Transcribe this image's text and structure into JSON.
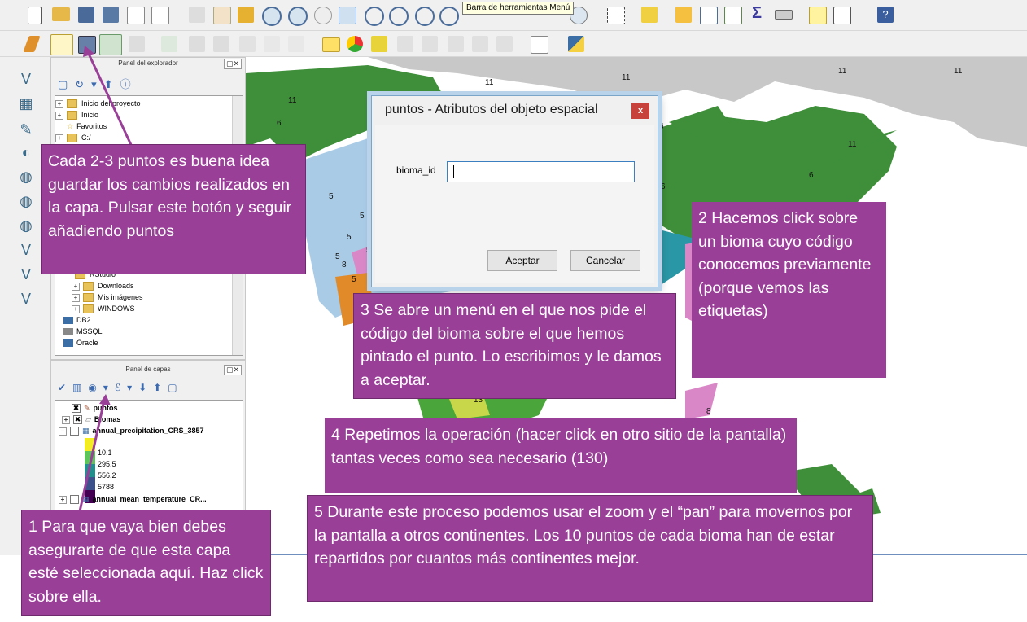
{
  "tooltip": "Barra de herramientas Menú",
  "browser_panel": {
    "title": "Panel del explorador",
    "items": [
      "Inicio del proyecto",
      "Inicio",
      "Favoritos",
      "C:/"
    ],
    "lower_items": [
      "RStudio",
      "Downloads",
      "Mis imágenes",
      "WINDOWS"
    ],
    "db_items": [
      "DB2",
      "MSSQL",
      "Oracle"
    ]
  },
  "layers_panel": {
    "title": "Panel de capas",
    "layers": [
      "puntos",
      "Biomas",
      "annual_precipitation_CRS_3857"
    ],
    "legend_values": [
      "10.1",
      "295.5",
      "556.2",
      "5788"
    ],
    "last_layer": "annual_mean_temperature_CR..."
  },
  "map": {
    "labels": [
      "11",
      "11",
      "11",
      "11",
      "11",
      "11",
      "6",
      "6",
      "6",
      "6",
      "5",
      "5",
      "5",
      "5",
      "5",
      "5",
      "8",
      "5",
      "8",
      "7",
      "8",
      "13",
      "7"
    ]
  },
  "dialog": {
    "title": "puntos - Atributos del objeto espacial",
    "close": "x",
    "field_label": "bioma_id",
    "field_value": "",
    "accept": "Aceptar",
    "cancel": "Cancelar"
  },
  "callouts": {
    "save": "Cada 2-3 puntos es buena idea guardar los cambios realizados en la capa. Pulsar este botón y seguir añadiendo puntos",
    "step2": "2 Hacemos click sobre un bioma cuyo código conocemos previamente (porque vemos las etiquetas)",
    "step3": "3 Se abre un menú en el que nos pide el código del bioma sobre el que hemos pintado el punto. Lo escribimos y le damos a aceptar.",
    "step4": "4 Repetimos la operación (hacer click en otro sitio de la pantalla) tantas veces como sea necesario (130)",
    "step5": "5 Durante este proceso podemos usar el zoom y el “pan” para movernos por la pantalla a otros continentes. Los 10 puntos de cada bioma han de estar repartidos por cuantos más continentes mejor.",
    "step1": "1 Para que vaya bien debes asegurarte de que esta capa esté seleccionada aquí. Haz click sobre ella."
  },
  "colors": {
    "callout": "#9a3f98",
    "arrow": "#9a3f98",
    "map_green": "#3f8f3a",
    "map_grey": "#c8c8c8",
    "map_blue": "#a9cbe6",
    "map_teal": "#2a97a6",
    "map_pink": "#d987c7"
  }
}
